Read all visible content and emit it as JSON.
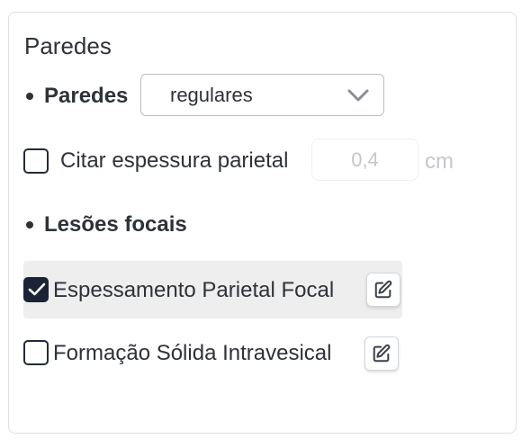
{
  "panel": {
    "title": "Paredes",
    "walls": {
      "label": "Paredes",
      "select_value": "regulares",
      "select_icon": "chevron-down-icon"
    },
    "thickness": {
      "checkbox_checked": false,
      "label": "Citar espessura parietal",
      "input_placeholder": "0,4",
      "unit": "cm"
    },
    "focal_lesions": {
      "label": "Lesões focais",
      "items": [
        {
          "label": "Espessamento Parietal Focal",
          "checked": true,
          "highlighted": true,
          "action_icon": "edit-icon"
        },
        {
          "label": "Formação Sólida Intravesical",
          "checked": false,
          "highlighted": false,
          "action_icon": "edit-icon"
        }
      ]
    }
  },
  "colors": {
    "text": "#2e3238",
    "muted": "#c4c7cc",
    "checkbox_checked": "#1b2436",
    "highlight_bg": "#eeeeee",
    "border": "#dcdfe3"
  }
}
